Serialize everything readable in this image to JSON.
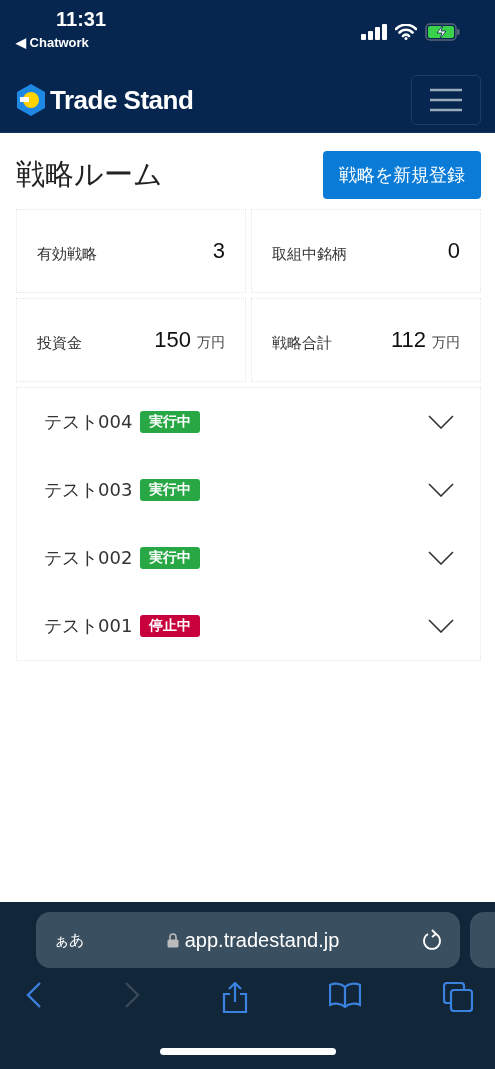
{
  "status_bar": {
    "time": "11:31",
    "back_app": "◀ Chatwork"
  },
  "navbar": {
    "brand": "Trade Stand"
  },
  "page": {
    "title": "戦略ルーム",
    "action": "戦略を新規登録"
  },
  "stats": [
    {
      "label": "有効戦略",
      "value": "3"
    },
    {
      "label": "取組中銘柄",
      "value": "0"
    },
    {
      "label": "投資金",
      "value": "150",
      "unit": "万円"
    },
    {
      "label": "戦略合計",
      "value": "112",
      "unit": "万円"
    }
  ],
  "strategies": [
    {
      "name": "テスト004",
      "status": "実行中",
      "color": "#28a745",
      "expanded": false
    },
    {
      "name": "テスト003",
      "status": "実行中",
      "color": "#28a745",
      "expanded": false
    },
    {
      "name": "テスト002",
      "status": "実行中",
      "color": "#28a745",
      "expanded": false
    },
    {
      "name": "テスト001",
      "status": "停止中",
      "color": "#c8003c",
      "expanded": false
    }
  ],
  "browser": {
    "text_size": "ぁあ",
    "url": "app.tradestand.jp",
    "forward_disabled": true
  }
}
